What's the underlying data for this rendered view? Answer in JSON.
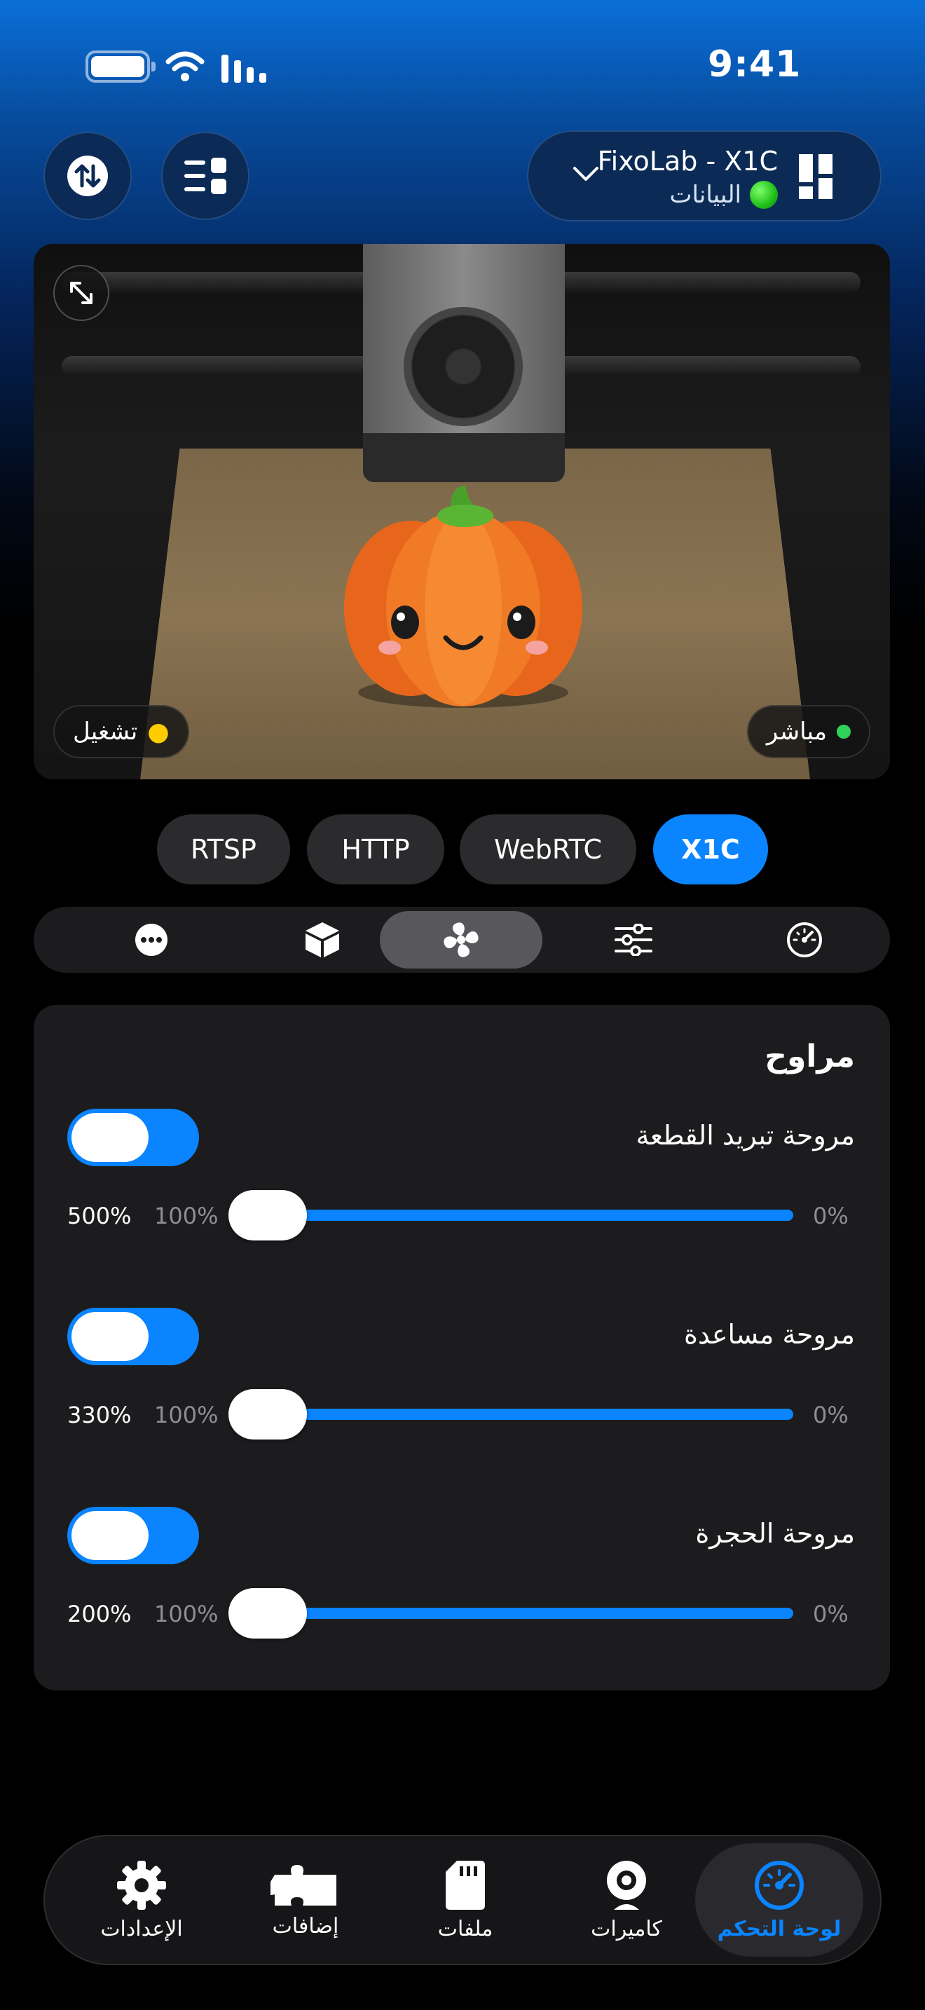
{
  "status_bar": {
    "time": "9:41"
  },
  "header": {
    "printer_name": "FixoLab - X1C",
    "printer_status": "البيانات"
  },
  "camera": {
    "light_label": "تشغيل",
    "live_label": "مباشر"
  },
  "sources": [
    "RTSP",
    "HTTP",
    "WebRTC",
    "X1C"
  ],
  "active_source": "X1C",
  "tabs": [
    "more",
    "filament",
    "fans",
    "tuning",
    "dashboard"
  ],
  "active_tab": "fans",
  "fans_card": {
    "title": "مراوح",
    "fans": [
      {
        "label": "مروحة تبريد القطعة",
        "enabled": true,
        "min": "0%",
        "mid": "100%",
        "max": "500%",
        "value_percent": 100
      },
      {
        "label": "مروحة مساعدة",
        "enabled": true,
        "min": "0%",
        "mid": "100%",
        "max": "330%",
        "value_percent": 100
      },
      {
        "label": "مروحة الحجرة",
        "enabled": true,
        "min": "0%",
        "mid": "100%",
        "max": "200%",
        "value_percent": 100
      }
    ]
  },
  "bottom_nav": {
    "items": [
      {
        "label": "الإعدادات",
        "icon": "gear-icon"
      },
      {
        "label": "إضافات",
        "icon": "puzzle-icon"
      },
      {
        "label": "ملفات",
        "icon": "sd-card-icon"
      },
      {
        "label": "كاميرات",
        "icon": "webcam-icon"
      },
      {
        "label": "لوحة التحكم",
        "icon": "gauge-icon"
      }
    ],
    "active": "لوحة التحكم"
  },
  "colors": {
    "accent": "#0a84ff",
    "card": "#1c1c1e",
    "header_blue": "#0b2b56"
  }
}
